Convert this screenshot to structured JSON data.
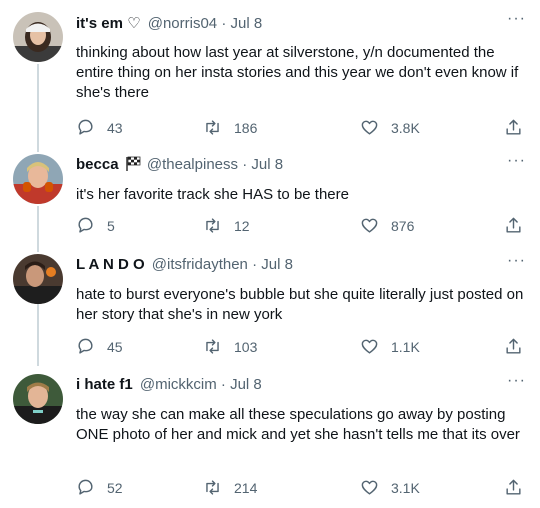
{
  "tweets": [
    {
      "name": "it's em ♡",
      "handle": "@norris04",
      "date": "Jul 8",
      "text": "thinking about how last year at silverstone, y/n documented the entire thing on her insta stories and this year we don't even know if she's there",
      "replies": "43",
      "retweets": "186",
      "likes": "3.8K"
    },
    {
      "name": "becca",
      "handle": "@thealpiness",
      "date": "Jul 8",
      "text": "it's her favorite track she HAS to be there",
      "replies": "5",
      "retweets": "12",
      "likes": "876"
    },
    {
      "name": "L A N D O",
      "handle": "@itsfridaythen",
      "date": "Jul 8",
      "text": "hate to burst everyone's bubble but she quite literally just posted on her story that she's in new york",
      "replies": "45",
      "retweets": "103",
      "likes": "1.1K"
    },
    {
      "name": "i hate f1",
      "handle": "@mickkcim",
      "date": "Jul 8",
      "text": "the way she can make all these speculations go away by posting ONE photo of her and mick and yet she hasn't tells me that its over",
      "replies": "52",
      "retweets": "214",
      "likes": "3.1K"
    }
  ],
  "separator": "·",
  "more_glyph": "···",
  "icons": {
    "reply": "reply-icon",
    "retweet": "retweet-icon",
    "like": "heart-icon",
    "share": "share-icon",
    "name_badge": "checkered-flag-icon"
  },
  "colors": {
    "text": "#0f1419",
    "muted": "#536471",
    "thread_line": "#cfd9de"
  }
}
